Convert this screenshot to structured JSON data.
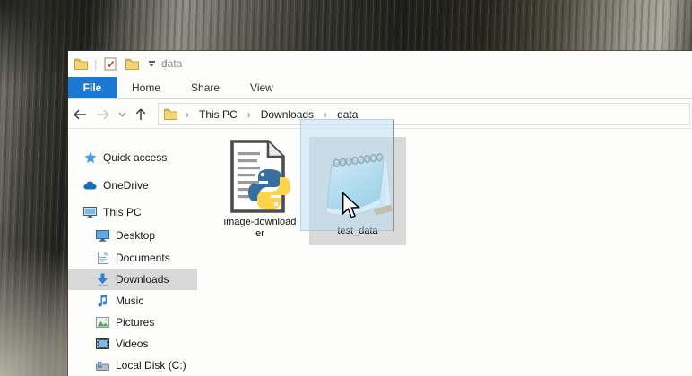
{
  "window": {
    "title": "data"
  },
  "qat": {
    "explorer_icon": "folder-icon",
    "properties_icon": "properties-check-icon",
    "new_folder_icon": "new-folder-icon",
    "separator": "|"
  },
  "tabs": {
    "file": "File",
    "home": "Home",
    "share": "Share",
    "view": "View"
  },
  "nav": {
    "breadcrumb": {
      "root": "This PC",
      "parent": "Downloads",
      "current": "data",
      "separator": "›"
    }
  },
  "sidebar": {
    "items": [
      {
        "label": "Quick access",
        "icon": "star-icon",
        "level": 0,
        "selected": false
      },
      {
        "label": "OneDrive",
        "icon": "cloud-icon",
        "level": 0,
        "selected": false
      },
      {
        "label": "This PC",
        "icon": "computer-icon",
        "level": 0,
        "selected": false
      },
      {
        "label": "Desktop",
        "icon": "desktop-icon",
        "level": 1,
        "selected": false
      },
      {
        "label": "Documents",
        "icon": "document-icon",
        "level": 1,
        "selected": false
      },
      {
        "label": "Downloads",
        "icon": "download-arrow-icon",
        "level": 1,
        "selected": true
      },
      {
        "label": "Music",
        "icon": "music-note-icon",
        "level": 1,
        "selected": false
      },
      {
        "label": "Pictures",
        "icon": "pictures-icon",
        "level": 1,
        "selected": false
      },
      {
        "label": "Videos",
        "icon": "videos-icon",
        "level": 1,
        "selected": false
      },
      {
        "label": "Local Disk (C:)",
        "icon": "disk-icon",
        "level": 1,
        "selected": false
      }
    ]
  },
  "files": [
    {
      "name": "image-downloader",
      "label_line1": "image-download",
      "label_line2": "er",
      "icon": "python-file-icon",
      "selected": false
    },
    {
      "name": "test_data",
      "label_line1": "test_data",
      "label_line2": "",
      "icon": "notepad-file-icon",
      "selected": true,
      "state": "being-dragged"
    }
  ],
  "colors": {
    "accent_blue": "#1d78d4",
    "selection_gray": "#d9d9d9",
    "drag_ghost_fill": "rgba(185,222,243,0.5)",
    "python_blue": "#366f9f",
    "python_yellow": "#ffd34a",
    "folder_yellow": "#f3d577",
    "sidebar_blue": "#2f80d6"
  }
}
